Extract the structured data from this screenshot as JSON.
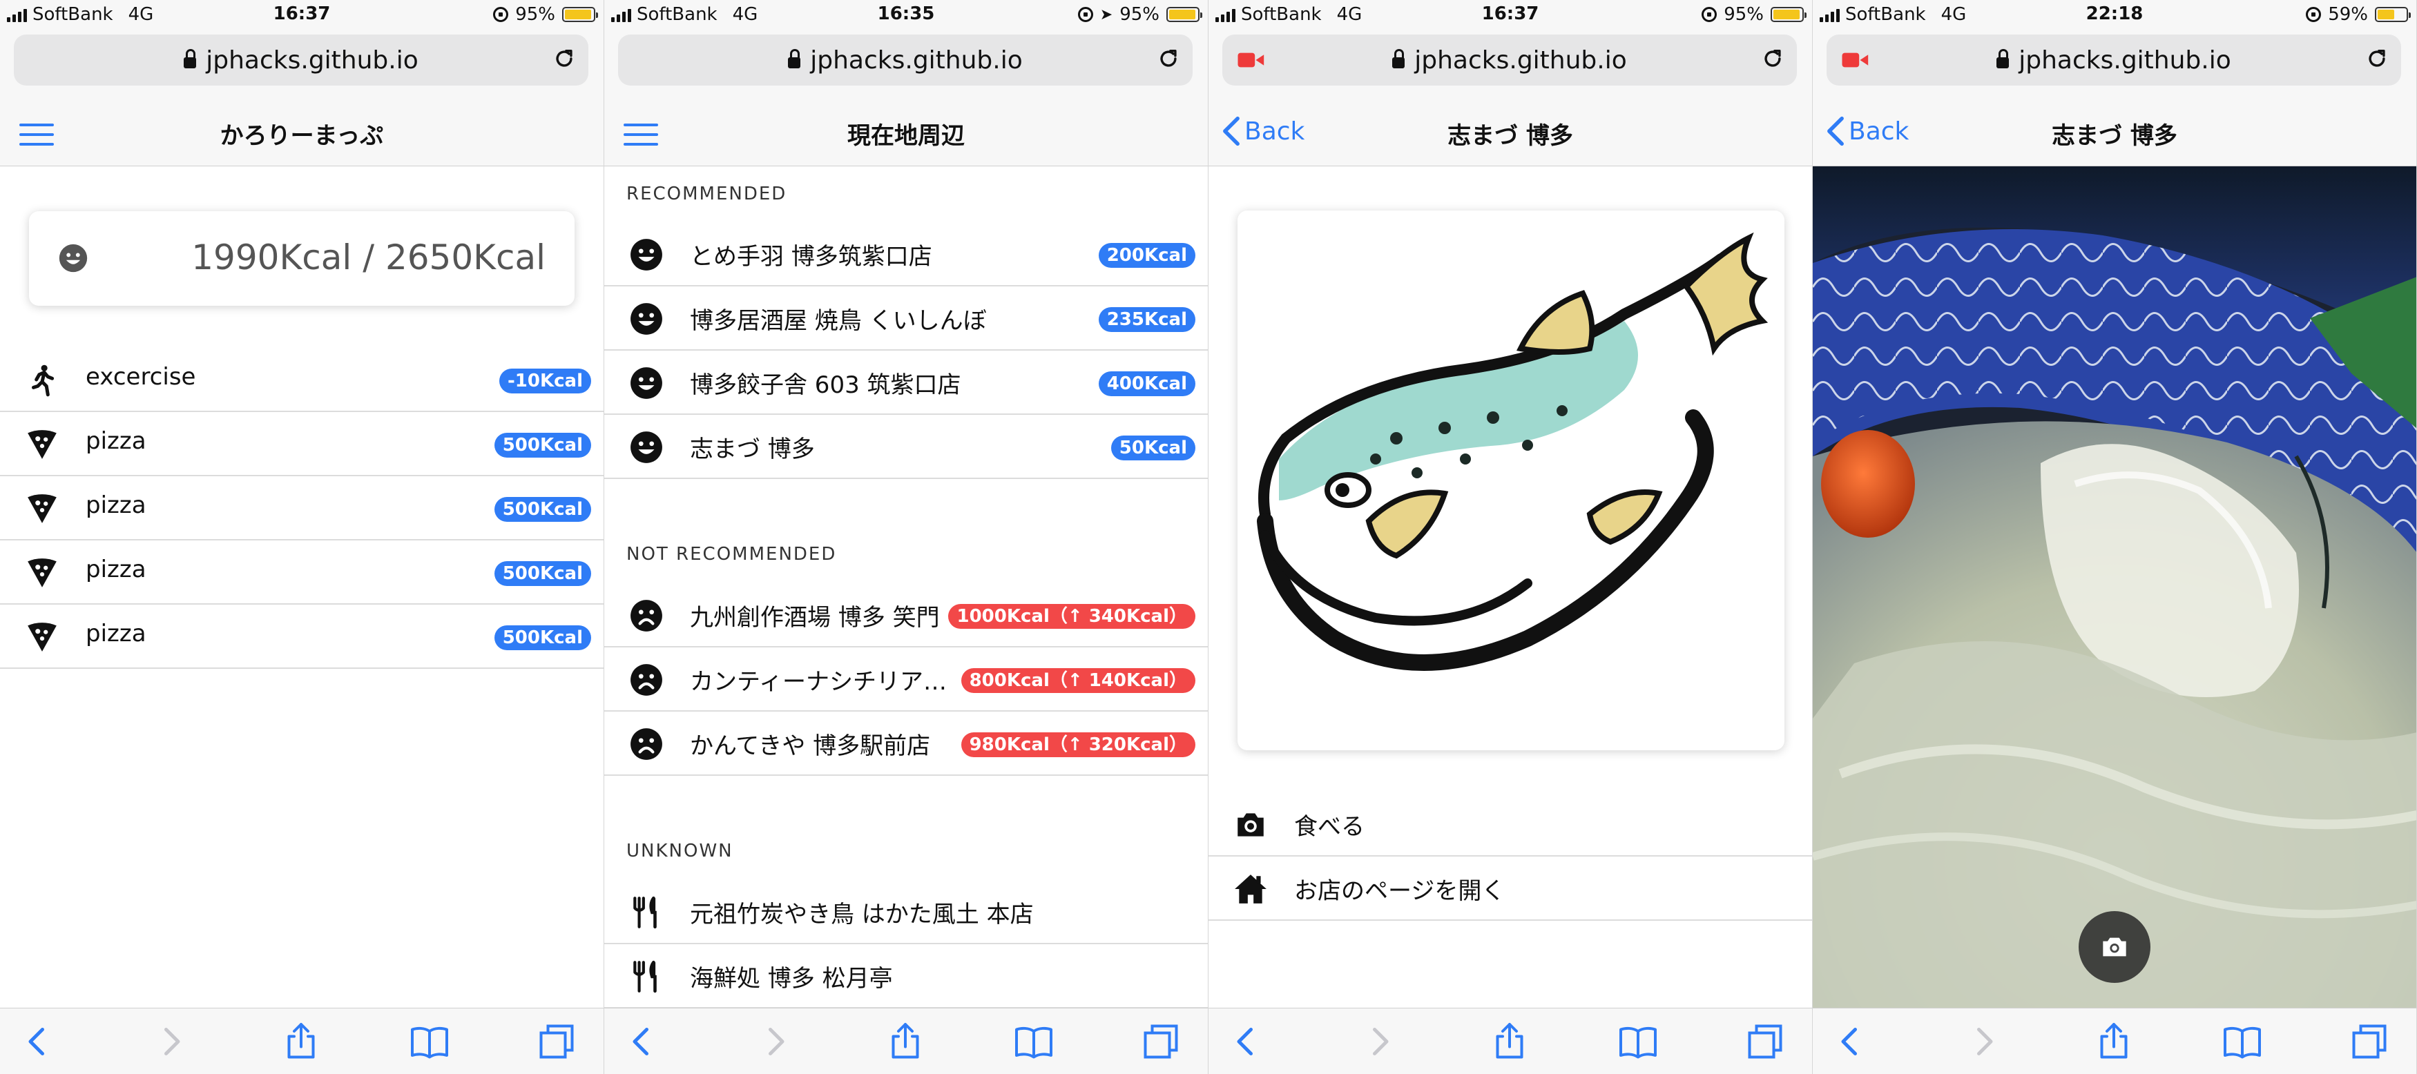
{
  "status_bars": [
    {
      "carrier": "SoftBank",
      "network": "4G",
      "time": "16:37",
      "battery": "95%",
      "battery_level": 0.95
    },
    {
      "carrier": "SoftBank",
      "network": "4G",
      "time": "16:35",
      "battery": "95%",
      "battery_level": 0.95
    },
    {
      "carrier": "SoftBank",
      "network": "4G",
      "time": "16:37",
      "battery": "95%",
      "battery_level": 0.95
    },
    {
      "carrier": "SoftBank",
      "network": "4G",
      "time": "22:18",
      "battery": "59%",
      "battery_level": 0.59
    }
  ],
  "url": "jphacks.github.io",
  "colors": {
    "accent": "#2f7cf6",
    "warning": "#f24848",
    "battery": "#f4c51c",
    "recording": "#ee3a3a"
  },
  "screen1": {
    "title": "かろりーまっぷ",
    "calories": "1990Kcal / 2650Kcal",
    "status_icon": "smile-icon",
    "items": [
      {
        "icon": "walk-icon",
        "label": "excercise",
        "kcal": "-10Kcal"
      },
      {
        "icon": "pizza-icon",
        "label": "pizza",
        "kcal": "500Kcal"
      },
      {
        "icon": "pizza-icon",
        "label": "pizza",
        "kcal": "500Kcal"
      },
      {
        "icon": "pizza-icon",
        "label": "pizza",
        "kcal": "500Kcal"
      },
      {
        "icon": "pizza-icon",
        "label": "pizza",
        "kcal": "500Kcal"
      }
    ]
  },
  "screen2": {
    "title": "現在地周辺",
    "recommended_header": "RECOMMENDED",
    "recommended": [
      {
        "label": "とめ手羽 博多筑紫口店",
        "kcal": "200Kcal"
      },
      {
        "label": "博多居酒屋 焼鳥 くいしんぼ",
        "kcal": "235Kcal"
      },
      {
        "label": "博多餃子舎 603 筑紫口店",
        "kcal": "400Kcal"
      },
      {
        "label": "志まづ 博多",
        "kcal": "50Kcal"
      }
    ],
    "not_recommended_header": "NOT RECOMMENDED",
    "not_recommended": [
      {
        "label": "九州創作酒場 博多 笑門",
        "kcal": "1000Kcal（↑ 340Kcal）"
      },
      {
        "label": "カンティーナシチリア…",
        "kcal": "800Kcal（↑ 140Kcal）"
      },
      {
        "label": "かんてきや 博多駅前店",
        "kcal": "980Kcal（↑ 320Kcal）"
      }
    ],
    "unknown_header": "UNKNOWN",
    "unknown": [
      {
        "label": "元祖竹炭やき鳥 はかた風土 本店"
      },
      {
        "label": "海鮮処 博多 松月亭"
      }
    ]
  },
  "screen3": {
    "back": "Back",
    "title": "志まづ 博多",
    "image_icon": "pufferfish-illustration",
    "actions": [
      {
        "icon": "camera-icon",
        "label": "食べる"
      },
      {
        "icon": "home-icon",
        "label": "お店のページを開く"
      }
    ]
  },
  "screen4": {
    "back": "Back",
    "title": "志まづ 博多",
    "photo": "fugu-sashimi-photo",
    "button_icon": "camera-icon"
  }
}
